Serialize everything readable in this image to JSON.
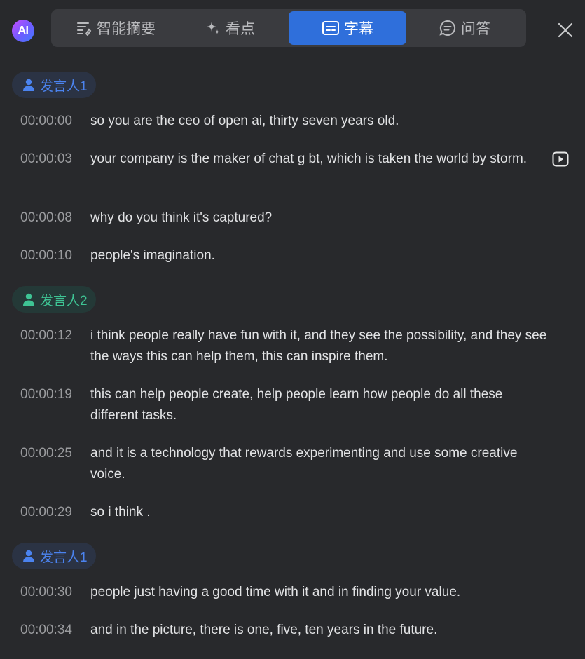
{
  "header": {
    "logo_text": "AI",
    "tabs": [
      {
        "label": "智能摘要",
        "icon": "summary-list-icon",
        "active": false
      },
      {
        "label": "看点",
        "icon": "sparkle-icon",
        "active": false
      },
      {
        "label": "字幕",
        "icon": "subtitle-icon",
        "active": true
      },
      {
        "label": "问答",
        "icon": "chat-bubble-icon",
        "active": false
      }
    ],
    "close_icon": "close-icon"
  },
  "colors": {
    "background": "#28292c",
    "active_tab": "#2f6fdb",
    "speaker1": "#4b83ef",
    "speaker2": "#3ec494"
  },
  "transcript": {
    "speakers": [
      "发言人1",
      "发言人2",
      "发言人1"
    ],
    "lines": [
      {
        "time": "00:00:00",
        "text": "so you are the ceo of open ai, thirty seven years old."
      },
      {
        "time": "00:00:03",
        "text": "your company is the maker of chat g bt, which is taken the world by storm."
      },
      {
        "time": "00:00:08",
        "text": "why do you think it's captured?"
      },
      {
        "time": "00:00:10",
        "text": "people's imagination."
      },
      {
        "time": "00:00:12",
        "text": "i think people really have fun with it, and they see the possibility, and they see the ways this can help them, this can inspire them."
      },
      {
        "time": "00:00:19",
        "text": "this can help people create, help people learn how people do all these different tasks."
      },
      {
        "time": "00:00:25",
        "text": "and it is a technology that rewards experimenting and use some creative voice."
      },
      {
        "time": "00:00:29",
        "text": "so i think ."
      },
      {
        "time": "00:00:30",
        "text": "people just having a good time with it and in finding your value."
      },
      {
        "time": "00:00:34",
        "text": "and in the picture, there is one, five, ten years in the future."
      }
    ]
  }
}
